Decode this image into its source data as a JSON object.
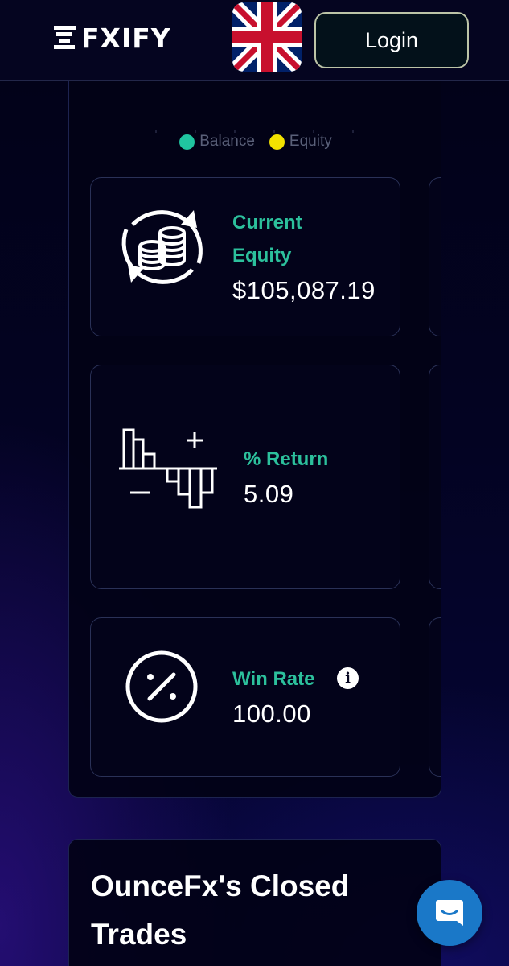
{
  "header": {
    "logo_text": "FXIFY",
    "language_flag": "uk-flag-icon",
    "login_label": "Login"
  },
  "chart": {
    "legend": [
      {
        "label": "Balance",
        "color": "#20c5a0"
      },
      {
        "label": "Equity",
        "color": "#f2e200"
      }
    ]
  },
  "cards": {
    "equity": {
      "icon": "coins-cycle-icon",
      "label_line1": "Current",
      "label_line2": "Equity",
      "value": "$105,087.19"
    },
    "return": {
      "icon": "return-chart-icon",
      "label": "% Return",
      "value": "5.09"
    },
    "winrate": {
      "icon": "percent-circle-icon",
      "label": "Win Rate",
      "value": "100.00",
      "info": "i"
    }
  },
  "trades": {
    "title": "OunceFx's Closed Trades"
  },
  "colors": {
    "accent": "#2cc09c",
    "background": "#02021a",
    "chat": "#1a78c8"
  }
}
